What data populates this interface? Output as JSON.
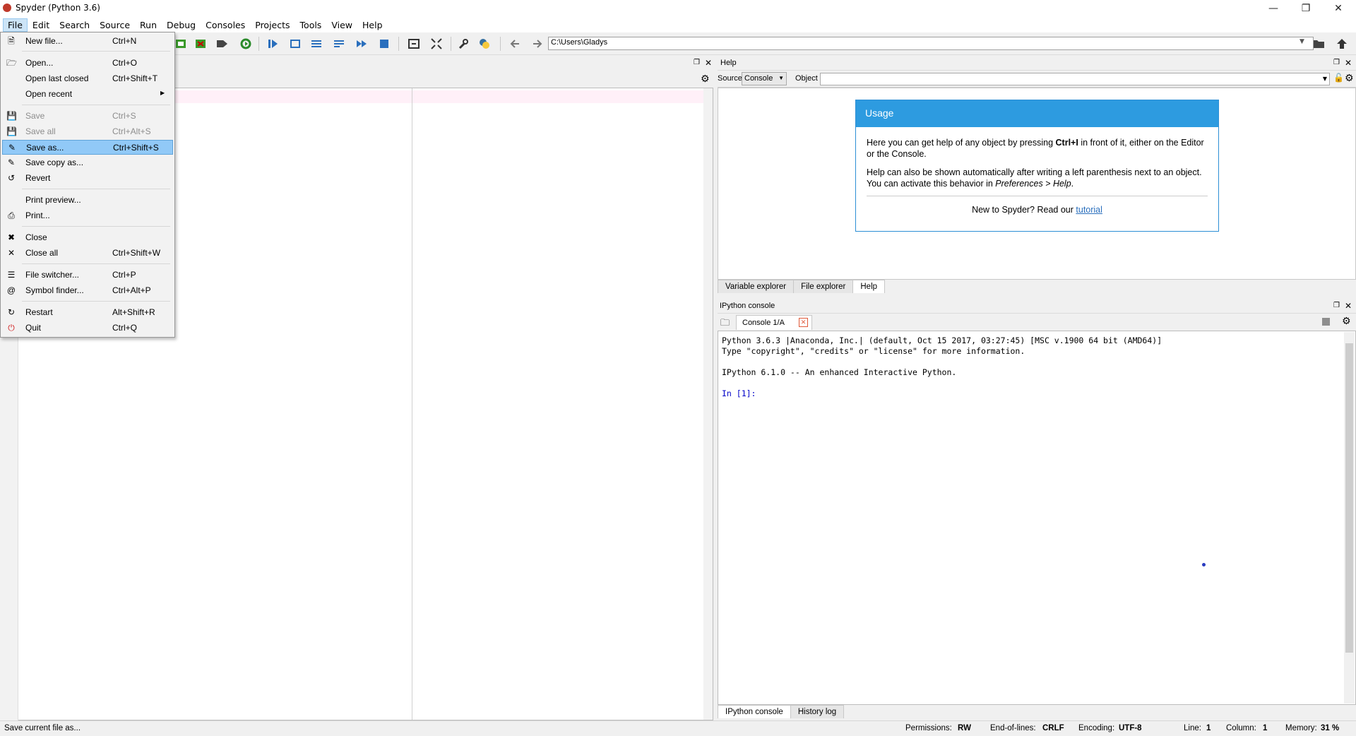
{
  "window": {
    "title": "Spyder (Python 3.6)"
  },
  "menubar": [
    "File",
    "Edit",
    "Search",
    "Source",
    "Run",
    "Debug",
    "Consoles",
    "Projects",
    "Tools",
    "View",
    "Help"
  ],
  "toolbar": {
    "path": "C:\\Users\\Gladys"
  },
  "file_menu": {
    "items": [
      {
        "label": "New file...",
        "shortcut": "Ctrl+N",
        "icon": "new-file-icon"
      },
      {
        "label": "Open...",
        "shortcut": "Ctrl+O",
        "icon": "open-folder-icon"
      },
      {
        "label": "Open last closed",
        "shortcut": "Ctrl+Shift+T"
      },
      {
        "label": "Open recent",
        "shortcut": "",
        "submenu": true
      },
      {
        "label": "Save",
        "shortcut": "Ctrl+S",
        "disabled": true,
        "icon": "save-icon"
      },
      {
        "label": "Save all",
        "shortcut": "Ctrl+Alt+S",
        "disabled": true,
        "icon": "save-all-icon"
      },
      {
        "label": "Save as...",
        "shortcut": "Ctrl+Shift+S",
        "highlighted": true,
        "icon": "save-as-icon"
      },
      {
        "label": "Save copy as...",
        "shortcut": "",
        "icon": "save-copy-icon"
      },
      {
        "label": "Revert",
        "shortcut": "",
        "icon": "revert-icon"
      },
      {
        "label": "Print preview...",
        "shortcut": ""
      },
      {
        "label": "Print...",
        "shortcut": "",
        "icon": "print-icon"
      },
      {
        "label": "Close",
        "shortcut": "",
        "icon": "close-icon"
      },
      {
        "label": "Close all",
        "shortcut": "Ctrl+Shift+W",
        "icon": "close-all-icon"
      },
      {
        "label": "File switcher...",
        "shortcut": "Ctrl+P",
        "icon": "list-icon"
      },
      {
        "label": "Symbol finder...",
        "shortcut": "Ctrl+Alt+P",
        "icon": "at-icon"
      },
      {
        "label": "Restart",
        "shortcut": "Alt+Shift+R",
        "icon": "restart-icon"
      },
      {
        "label": "Quit",
        "shortcut": "Ctrl+Q",
        "icon": "power-icon"
      }
    ]
  },
  "help": {
    "title": "Help",
    "source_label": "Source",
    "source_value": "Console",
    "object_label": "Object",
    "usage_title": "Usage",
    "usage_p1a": "Here you can get help of any object by pressing ",
    "usage_p1b": "Ctrl+I",
    "usage_p1c": " in front of it, either on the Editor or the Console.",
    "usage_p2a": "Help can also be shown automatically after writing a left parenthesis next to an object. You can activate this behavior in ",
    "usage_p2b": "Preferences > Help",
    "usage_p2c": ".",
    "new_to": "New to Spyder? Read our ",
    "tutorial": "tutorial",
    "tabs": [
      "Variable explorer",
      "File explorer",
      "Help"
    ]
  },
  "console": {
    "title": "IPython console",
    "tab": "Console 1/A",
    "lines": [
      "Python 3.6.3 |Anaconda, Inc.| (default, Oct 15 2017, 03:27:45) [MSC v.1900 64 bit (AMD64)]",
      "Type \"copyright\", \"credits\" or \"license\" for more information.",
      "",
      "IPython 6.1.0 -- An enhanced Interactive Python.",
      ""
    ],
    "prompt": "In [1]:",
    "bottom_tabs": [
      "IPython console",
      "History log"
    ]
  },
  "status": {
    "message": "Save current file as...",
    "permissions_label": "Permissions:",
    "permissions": "RW",
    "eol_label": "End-of-lines:",
    "eol": "CRLF",
    "encoding_label": "Encoding:",
    "encoding": "UTF-8",
    "line_label": "Line:",
    "line": "1",
    "column_label": "Column:",
    "column": "1",
    "memory_label": "Memory:",
    "memory": "31 %"
  },
  "colors": {
    "accent": "#2d9be0",
    "highlight": "#91c9f7",
    "prompt": "#0000c8"
  }
}
